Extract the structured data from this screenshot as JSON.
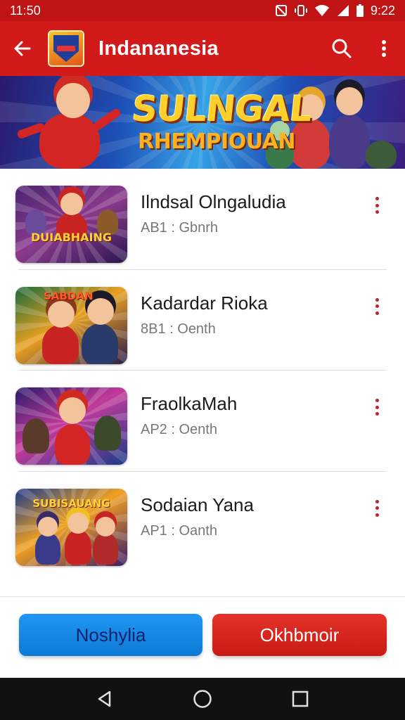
{
  "status_bar": {
    "time_left": "11:50",
    "time_right": "9:22",
    "icons": [
      "notification-off-icon",
      "vibrate-icon",
      "wifi-icon",
      "signal-icon",
      "battery-icon"
    ]
  },
  "app_bar": {
    "title": "Indananesia",
    "icons": [
      "back-arrow-icon",
      "app-logo",
      "search-icon",
      "more-vert-icon"
    ]
  },
  "banner": {
    "title": "SULNGAL",
    "subtitle": "RHEMPIOUAN"
  },
  "list": {
    "items": [
      {
        "title": "Ilndsal Olngaludia",
        "subtitle": "AB1 : Gbnrh",
        "thumb_text": "DUIABHAING"
      },
      {
        "title": "Kadardar Rioka",
        "subtitle": "8B1 : Oenth",
        "thumb_text": "SABDAN"
      },
      {
        "title": "FraolkaMah",
        "subtitle": "AP2 : Oenth",
        "thumb_text": ""
      },
      {
        "title": "Sodaian Yana",
        "subtitle": "AP1 : Oanth",
        "thumb_text": "SUBISAUANG"
      }
    ]
  },
  "actions": {
    "primary_label": "Noshylia",
    "secondary_label": "Okhbmoir"
  },
  "colors": {
    "app_bar": "#d31a1a",
    "status_bar": "#c01414",
    "primary_button": "#1c8eea",
    "secondary_button": "#d82219",
    "more_dots": "#b02a2a"
  },
  "nav_bar": {
    "icons": [
      "nav-back-icon",
      "nav-home-icon",
      "nav-recents-icon"
    ]
  }
}
